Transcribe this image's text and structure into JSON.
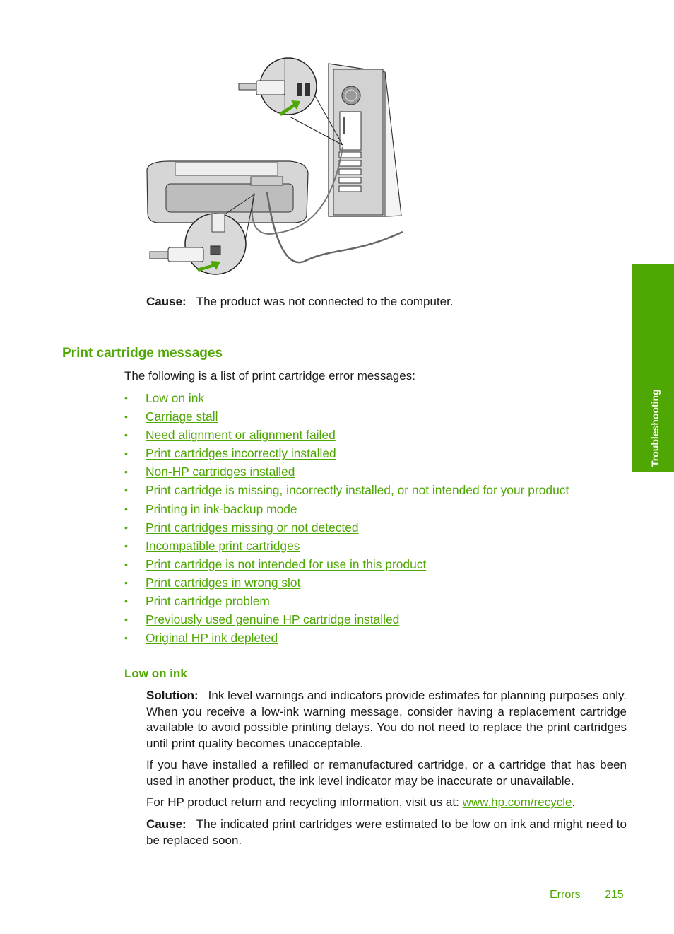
{
  "figure": {
    "description": "Illustration of USB cable connecting the back of the printer to a computer tower, with magnified insets showing USB ports and green insertion arrows",
    "accent_color": "#4ea702"
  },
  "top_cause": {
    "label": "Cause:",
    "text": "The product was not connected to the computer."
  },
  "section": {
    "heading": "Print cartridge messages",
    "intro": "The following is a list of print cartridge error messages:",
    "bullet": "•",
    "links": [
      "Low on ink",
      "Carriage stall",
      "Need alignment or alignment failed",
      "Print cartridges incorrectly installed",
      "Non-HP cartridges installed",
      "Print cartridge is missing, incorrectly installed, or not intended for your product",
      "Printing in ink-backup mode",
      "Print cartridges missing or not detected",
      "Incompatible print cartridges",
      "Print cartridge is not intended for use in this product",
      "Print cartridges in wrong slot",
      "Print cartridge problem",
      "Previously used genuine HP cartridge installed",
      "Original HP ink depleted"
    ]
  },
  "low_on_ink": {
    "heading": "Low on ink",
    "solution_label": "Solution:",
    "solution_text": "Ink level warnings and indicators provide estimates for planning purposes only. When you receive a low-ink warning message, consider having a replacement cartridge available to avoid possible printing delays. You do not need to replace the print cartridges until print quality becomes unacceptable.",
    "refill_text": "If you have installed a refilled or remanufactured cartridge, or a cartridge that has been used in another product, the ink level indicator may be inaccurate or unavailable.",
    "recycle_prefix": "For HP product return and recycling information, visit us at: ",
    "recycle_link": "www.hp.com/recycle",
    "recycle_suffix": ".",
    "cause_label": "Cause:",
    "cause_text": "The indicated print cartridges were estimated to be low on ink and might need to be replaced soon."
  },
  "side_tab": {
    "label": "Troubleshooting"
  },
  "footer": {
    "section": "Errors",
    "page": "215"
  }
}
